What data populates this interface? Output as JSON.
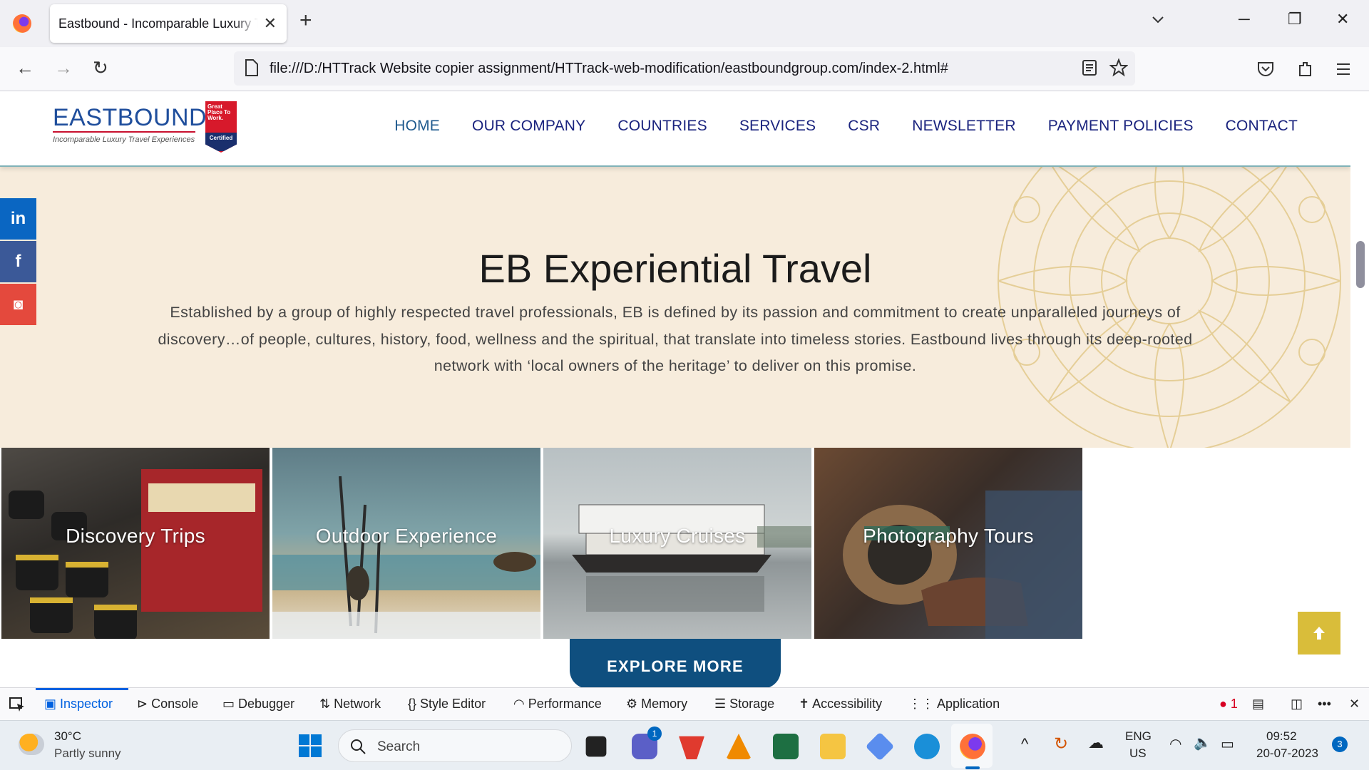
{
  "browser": {
    "tab_title": "Eastbound - Incomparable Luxury Travel Experiences",
    "url": "file:///D:/HTTrack Website copier assignment/HTTrack-web-modification/eastboundgroup.com/index-2.html#"
  },
  "site": {
    "logo_text": "EASTBOUND",
    "logo_tagline": "Incomparable Luxury Travel Experiences",
    "badge_lines": "Great Place To Work.",
    "badge_cert": "Certified",
    "menu": [
      "HOME",
      "OUR COMPANY",
      "COUNTRIES",
      "SERVICES",
      "CSR",
      "NEWSLETTER",
      "PAYMENT POLICIES",
      "CONTACT"
    ],
    "social": [
      {
        "name": "linkedin-icon",
        "glyph": "in",
        "color": "#0a66c2"
      },
      {
        "name": "facebook-icon",
        "glyph": "f",
        "color": "#3b5998"
      },
      {
        "name": "instagram-icon",
        "glyph": "◙",
        "color": "#e4493d"
      }
    ],
    "hero_title": "EB Experiential Travel",
    "hero_text": "Established by a group of highly respected travel professionals, EB is defined by its passion and commitment to create unparalleled journeys of discovery…of people, cultures, history, food, wellness and the spiritual, that translate into timeless stories. Eastbound lives through its deep-rooted network with ‘local owners of the heritage’ to deliver on this promise.",
    "cards": [
      "Discovery Trips",
      "Outdoor Experience",
      "Luxury Cruises",
      "Photography Tours"
    ],
    "explore_label": "EXPLORE MORE",
    "back_to_top_icon": "arrow-up-icon"
  },
  "devtools": {
    "tabs": [
      "Inspector",
      "Console",
      "Debugger",
      "Network",
      "Style Editor",
      "Performance",
      "Memory",
      "Storage",
      "Accessibility",
      "Application"
    ],
    "active": "Inspector",
    "error_count": "1"
  },
  "taskbar": {
    "temperature": "30°C",
    "weather": "Partly sunny",
    "search_placeholder": "Search",
    "lang_top": "ENG",
    "lang_bottom": "US",
    "time": "09:52",
    "date": "20-07-2023",
    "notification_count": "3",
    "teams_badge": "1"
  }
}
